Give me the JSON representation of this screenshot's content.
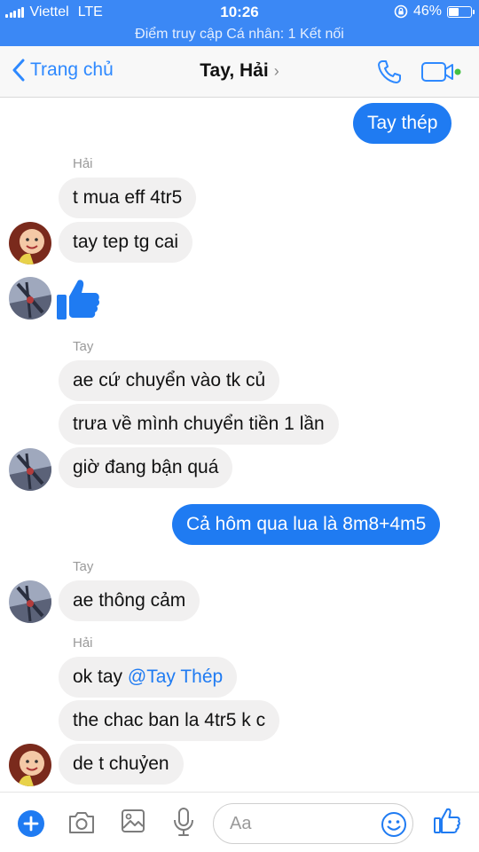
{
  "status": {
    "carrier": "Viettel",
    "network": "LTE",
    "time": "10:26",
    "battery": "46%",
    "battery_level": 0.46
  },
  "hotspot": "Điểm truy cập Cá nhân: 1 Kết nối",
  "header": {
    "back_label": "Trang chủ",
    "title": "Tay, Hải",
    "title_chevron": "›"
  },
  "messages": [
    {
      "side": "out",
      "text": "Tay thép"
    },
    {
      "side": "in",
      "sender": "Hải",
      "text": "t mua eff 4tr5"
    },
    {
      "side": "in",
      "text": "tay tep tg cai"
    },
    {
      "side": "in",
      "sticker": "thumbs-up"
    },
    {
      "side": "in",
      "sender": "Tay",
      "text": "ae cứ chuyển vào tk củ"
    },
    {
      "side": "in",
      "text": "trưa về mình chuyển tiền 1 lần"
    },
    {
      "side": "in",
      "text": "giờ đang bận quá"
    },
    {
      "side": "out",
      "text": "Cả hôm qua lua là 8m8+4m5"
    },
    {
      "side": "in",
      "sender": "Tay",
      "text": "ae thông cảm"
    },
    {
      "side": "in",
      "sender": "Hải",
      "text": "ok tay ",
      "mention": "@Tay Thép"
    },
    {
      "side": "in",
      "text": "the chac ban la 4tr5 k c"
    },
    {
      "side": "in",
      "text": "de t chuỷen"
    }
  ],
  "composer": {
    "placeholder": "Aa"
  },
  "colors": {
    "status_bar": "#3b88f5",
    "outgoing_bubble": "#1f7bf2",
    "incoming_bubble": "#f1f0f0",
    "accent": "#2e89ff",
    "active_dot": "#44c043"
  },
  "icons": {
    "back": "chevron-left-icon",
    "call": "phone-icon",
    "video": "video-camera-icon",
    "add": "plus-icon",
    "camera": "camera-icon",
    "gallery": "image-icon",
    "mic": "microphone-icon",
    "emoji": "smiley-icon",
    "like": "thumbs-up-icon"
  }
}
